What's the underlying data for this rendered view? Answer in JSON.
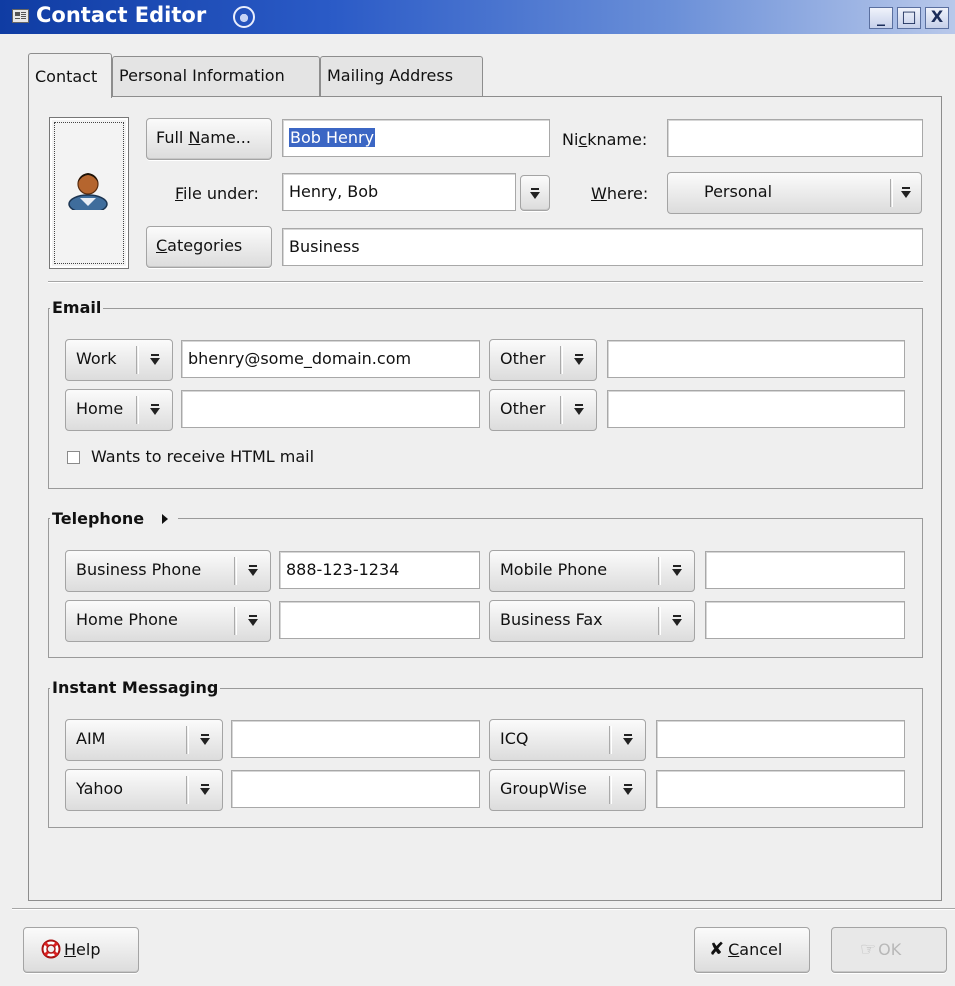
{
  "window": {
    "title": "Contact Editor",
    "buttons": {
      "minimize": "_",
      "maximize": "□",
      "close": "X"
    }
  },
  "tabs": [
    {
      "label": "Contact",
      "active": true
    },
    {
      "label": "Personal Information",
      "active": false
    },
    {
      "label": "Mailing Address",
      "active": false
    }
  ],
  "identity": {
    "full_name_button": {
      "pre": "Full ",
      "mnemonic": "N",
      "post": "ame..."
    },
    "full_name_value": "Bob Henry",
    "nickname_label": {
      "pre": "Ni",
      "mnemonic": "c",
      "post": "kname:"
    },
    "nickname_value": "",
    "file_under_label": {
      "pre": "",
      "mnemonic": "F",
      "post": "ile under:"
    },
    "file_under_value": "Henry, Bob",
    "where_label": {
      "pre": "",
      "mnemonic": "W",
      "post": "here:"
    },
    "where_value": "Personal",
    "categories_button": {
      "pre": "",
      "mnemonic": "C",
      "post": "ategories"
    },
    "categories_value": "Business"
  },
  "email": {
    "title": "Email",
    "rows": [
      {
        "type1": "Work",
        "value1": "bhenry@some_domain.com",
        "type2": "Other",
        "value2": ""
      },
      {
        "type1": "Home",
        "value1": "",
        "type2": "Other",
        "value2": ""
      }
    ],
    "html_mail_label": "Wants to receive HTML mail",
    "html_mail_checked": false
  },
  "telephone": {
    "title": "Telephone",
    "expander_icon": "triangle-right-icon",
    "rows": [
      {
        "type1": "Business Phone",
        "value1": "888-123-1234",
        "type2": "Mobile Phone",
        "value2": ""
      },
      {
        "type1": "Home Phone",
        "value1": "",
        "type2": "Business Fax",
        "value2": ""
      }
    ]
  },
  "im": {
    "title": "Instant Messaging",
    "rows": [
      {
        "type1": "AIM",
        "value1": "",
        "type2": "ICQ",
        "value2": ""
      },
      {
        "type1": "Yahoo",
        "value1": "",
        "type2": "GroupWise",
        "value2": ""
      }
    ]
  },
  "footer": {
    "help": {
      "pre": "",
      "mnemonic": "H",
      "post": "elp"
    },
    "cancel": {
      "pre": "",
      "mnemonic": "C",
      "post": "ancel"
    },
    "ok": "OK"
  },
  "colors": {
    "titlebar": "#0f3ca3",
    "selection": "#3b66c4",
    "window_bg": "#efefef"
  }
}
